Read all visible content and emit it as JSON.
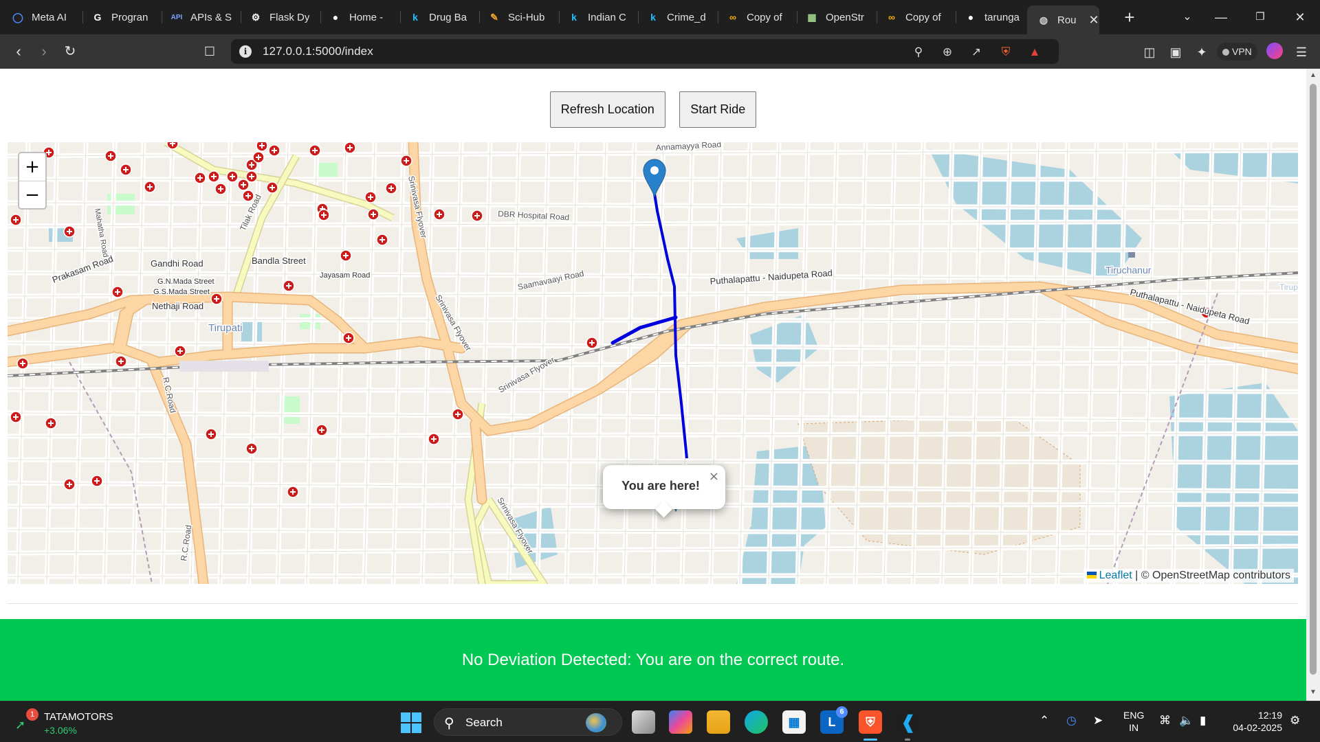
{
  "browser": {
    "tabs": [
      {
        "title": "Meta AI",
        "icon": "meta-ai-icon"
      },
      {
        "title": "Progran",
        "icon": "google-icon"
      },
      {
        "title": "APIs & S",
        "icon": "api-icon"
      },
      {
        "title": "Flask Dy",
        "icon": "chatgpt-icon"
      },
      {
        "title": "Home -",
        "icon": "github-icon"
      },
      {
        "title": "Drug Ba",
        "icon": "kaggle-icon"
      },
      {
        "title": "Sci-Hub",
        "icon": "scihub-icon"
      },
      {
        "title": "Indian C",
        "icon": "kaggle-icon"
      },
      {
        "title": "Crime_d",
        "icon": "kaggle-icon"
      },
      {
        "title": "Copy of",
        "icon": "colab-icon"
      },
      {
        "title": "OpenStr",
        "icon": "openstreetmap-icon"
      },
      {
        "title": "Copy of",
        "icon": "colab-icon"
      },
      {
        "title": "tarunga",
        "icon": "github-icon"
      },
      {
        "title": "Rou",
        "icon": "globe-icon"
      }
    ],
    "active_tab_index": 13,
    "new_tab_label": "+",
    "url": "127.0.0.1:5000/index",
    "vpn_label": "VPN"
  },
  "page": {
    "buttons": {
      "refresh_location": "Refresh Location",
      "start_ride": "Start Ride"
    },
    "map": {
      "zoom_in": "+",
      "zoom_out": "−",
      "popup_text": "You are here!",
      "popup_close": "×",
      "attribution_leaflet": "Leaflet",
      "attribution_rest": " | © OpenStreetMap contributors",
      "labels": {
        "annamayya_road": "Annamayya Road",
        "dbr_hospital_road": "DBR Hospital Road",
        "gandhi_road": "Gandhi Road",
        "bandla_street": "Bandla Street",
        "prakasam_road": "Prakasam Road",
        "gn_mada_street": "G.N.Mada Street",
        "gs_mada_street": "G.S.Mada Street",
        "nethaji_road": "Nethaji Road",
        "jayasam_road": "Jayasam Road",
        "tirupati": "Tirupati",
        "srinivasa_flyover_1": "Srinivasa Flyover",
        "srinivasa_flyover_2": "Srinivasa Flyover",
        "srinivasa_flyover_3": "Srinivasa Flyover",
        "srinivasa_flyover_4": "Srinivasa Flyover",
        "saamavaayi_road": "Saamavaayi Road",
        "puthalapattu_1": "Puthalapattu - Naidupeta Road",
        "puthalapattu_2": "Puthalapattu - Naidupeta Road",
        "tiruchanur": "Tiruchanur",
        "tilak_road": "Tilak Road",
        "mahatha_road": "Mahatha Road",
        "rc_road_1": "R.C.Road",
        "rc_road_2": "R.C.Road",
        "tirupati_edge": "Tirup"
      },
      "colors": {
        "route": "#0000dd",
        "marker": "#2a81cb",
        "hospital": "#cc1b1b",
        "water": "#aad3df",
        "major_road": "#fcd6a4",
        "secondary_road": "#f7fabf",
        "railway": "#808080"
      }
    },
    "status_message": "No Deviation Detected: You are on the correct route.",
    "status_color": "#00c853"
  },
  "taskbar": {
    "stock_name": "TATAMOTORS",
    "stock_change": "+3.06%",
    "stock_badge": "1",
    "search_label": "Search",
    "apps": [
      "file-explorer-icon",
      "copilot-icon",
      "folder-icon",
      "edge-icon",
      "store-icon",
      "linkedin-icon",
      "brave-icon",
      "vscode-icon"
    ],
    "linkedin_badge": "6",
    "language_line1": "ENG",
    "language_line2": "IN",
    "time": "12:19",
    "date": "04-02-2025"
  }
}
